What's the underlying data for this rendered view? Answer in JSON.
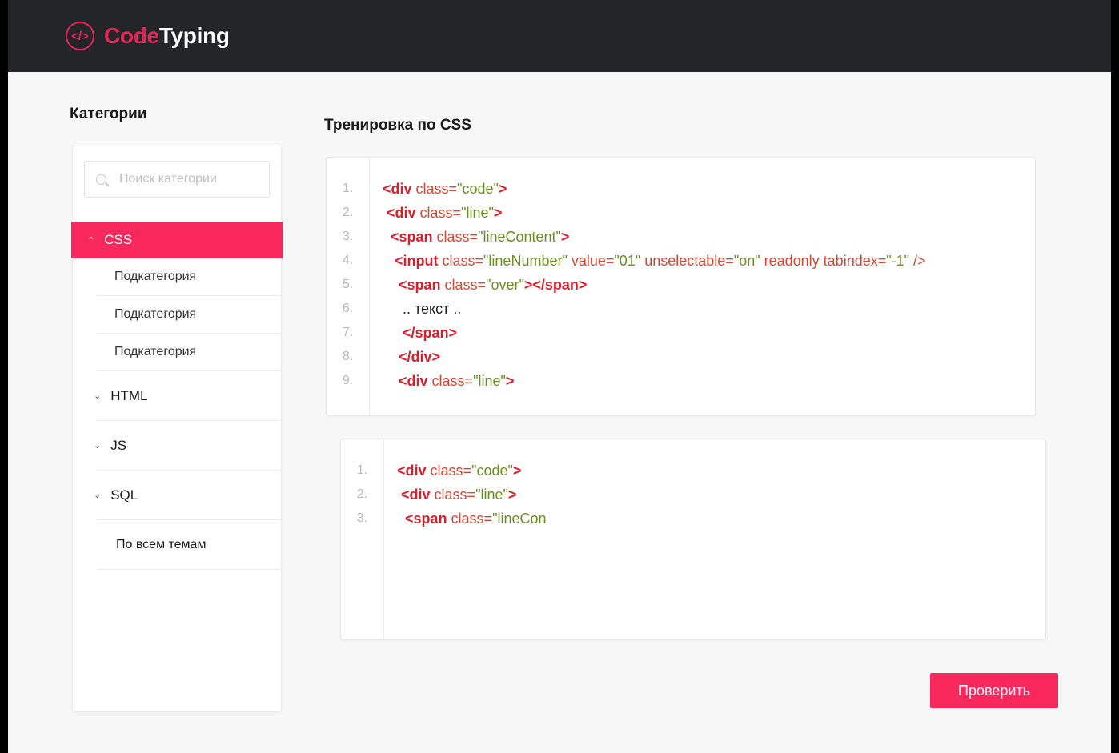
{
  "header": {
    "logo_icon": "</>",
    "logo_code": "Code",
    "logo_typing": "Typing"
  },
  "colors": {
    "accent": "#f8285d",
    "header_bg": "#232528",
    "tag": "#d81f2c",
    "string": "#6b8e23"
  },
  "sidebar": {
    "title": "Категории",
    "search_placeholder": "Поиск категории",
    "active_category": {
      "label": "CSS",
      "icon": "chevron-up-icon"
    },
    "subcategories": [
      "Подкатегория",
      "Подкатегория",
      "Подкатегория"
    ],
    "categories": [
      {
        "label": "HTML",
        "icon": "chevron-down-icon"
      },
      {
        "label": "JS",
        "icon": "chevron-down-icon"
      },
      {
        "label": "SQL",
        "icon": "chevron-down-icon"
      }
    ],
    "all_topics": "По всем темам"
  },
  "main": {
    "title": "Тренировка по CSS",
    "reference_code": {
      "line_numbers": [
        "1.",
        "2.",
        "3.",
        "4.",
        "5.",
        "6.",
        "7.",
        "8.",
        "9."
      ],
      "lines": [
        [
          [
            "<div",
            "tag"
          ],
          [
            " class=",
            "attr"
          ],
          [
            "\"code\"",
            "str"
          ],
          [
            ">",
            "tag"
          ]
        ],
        [
          [
            " <div",
            "tag"
          ],
          [
            " class=",
            "attr"
          ],
          [
            "\"line\"",
            "str"
          ],
          [
            ">",
            "tag"
          ]
        ],
        [
          [
            "  <span",
            "tag"
          ],
          [
            " class=",
            "attr"
          ],
          [
            "\"lineContent\"",
            "str"
          ],
          [
            ">",
            "tag"
          ]
        ],
        [
          [
            "   <input",
            "tag"
          ],
          [
            " class=",
            "attr"
          ],
          [
            "\"lineNumber\"",
            "str"
          ],
          [
            " value=",
            "attr"
          ],
          [
            "\"01\"",
            "str"
          ],
          [
            " unselectable=",
            "attr"
          ],
          [
            "\"on\"",
            "str"
          ],
          [
            " readonly tabindex=",
            "attr"
          ],
          [
            "\"-1\"",
            "str"
          ],
          [
            " />",
            "attr"
          ]
        ],
        [
          [
            "    <span",
            "tag"
          ],
          [
            " class=",
            "attr"
          ],
          [
            "\"over\"",
            "str"
          ],
          [
            "></span>",
            "tag"
          ]
        ],
        [
          [
            "     .. текст ..",
            "txt"
          ]
        ],
        [
          [
            "     </span>",
            "tag"
          ]
        ],
        [
          [
            "    </div>",
            "tag"
          ]
        ],
        [
          [
            "    <div",
            "tag"
          ],
          [
            " class=",
            "attr"
          ],
          [
            "\"line\"",
            "str"
          ],
          [
            ">",
            "tag"
          ]
        ]
      ]
    },
    "typed_code": {
      "line_numbers": [
        "1.",
        "2.",
        "3."
      ],
      "lines": [
        [
          [
            "<div",
            "tag"
          ],
          [
            " class=",
            "attr"
          ],
          [
            "\"code\"",
            "str"
          ],
          [
            ">",
            "tag"
          ]
        ],
        [
          [
            " <div",
            "tag"
          ],
          [
            " class=",
            "attr"
          ],
          [
            "\"line\"",
            "str"
          ],
          [
            ">",
            "tag"
          ]
        ],
        [
          [
            "  <span",
            "tag"
          ],
          [
            " class=",
            "attr"
          ],
          [
            "\"lineCon",
            "str"
          ]
        ]
      ]
    },
    "check_button": "Проверить"
  }
}
